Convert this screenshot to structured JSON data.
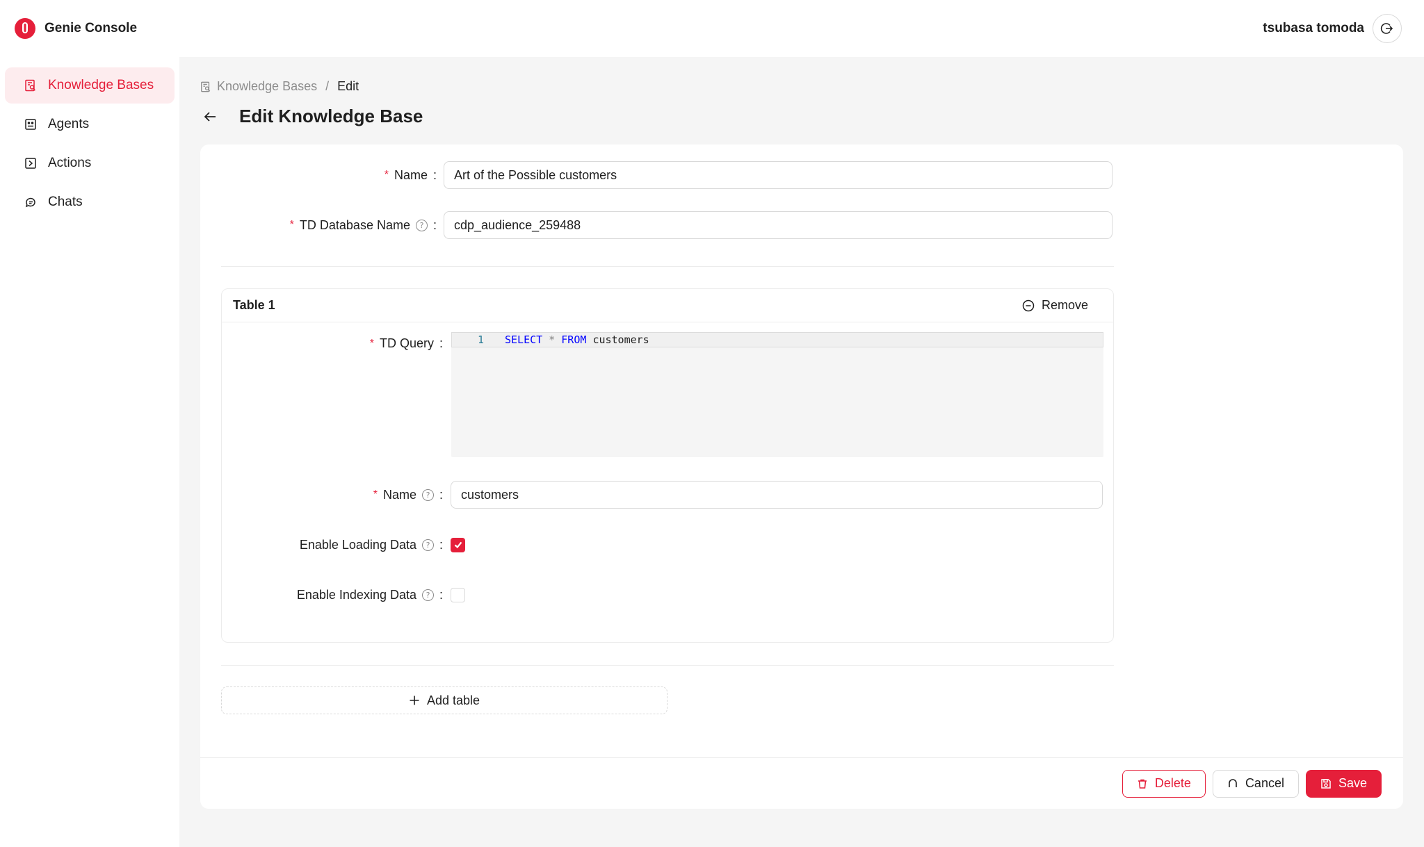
{
  "app": {
    "title": "Genie Console",
    "logo_icon": "genie-logo-icon",
    "brand_color": "#e51f3a"
  },
  "user": {
    "name": "tsubasa tomoda"
  },
  "sidebar": {
    "items": [
      {
        "label": "Knowledge Bases",
        "icon": "knowledge-base-icon",
        "active": true
      },
      {
        "label": "Agents",
        "icon": "agent-icon",
        "active": false
      },
      {
        "label": "Actions",
        "icon": "action-icon",
        "active": false
      },
      {
        "label": "Chats",
        "icon": "chat-icon",
        "active": false
      }
    ]
  },
  "breadcrumb": {
    "parent": "Knowledge Bases",
    "separator": "/",
    "current": "Edit"
  },
  "page": {
    "title": "Edit Knowledge Base"
  },
  "form": {
    "name_label": "Name",
    "name_value": "Art of the Possible customers",
    "db_label": "TD Database Name",
    "db_value": "cdp_audience_259488",
    "colon": ":",
    "required_mark": "*",
    "help_mark": "?"
  },
  "table": {
    "title": "Table 1",
    "remove_label": "Remove",
    "query_label": "TD Query",
    "query_line_no": "1",
    "query_kw1": "SELECT",
    "query_star": "*",
    "query_kw2": "FROM",
    "query_table": "customers",
    "name_label": "Name",
    "name_value": "customers",
    "loading_label": "Enable Loading Data",
    "loading_checked": true,
    "indexing_label": "Enable Indexing Data",
    "indexing_checked": false
  },
  "add_table_label": "Add table",
  "footer": {
    "delete_label": "Delete",
    "cancel_label": "Cancel",
    "save_label": "Save"
  }
}
